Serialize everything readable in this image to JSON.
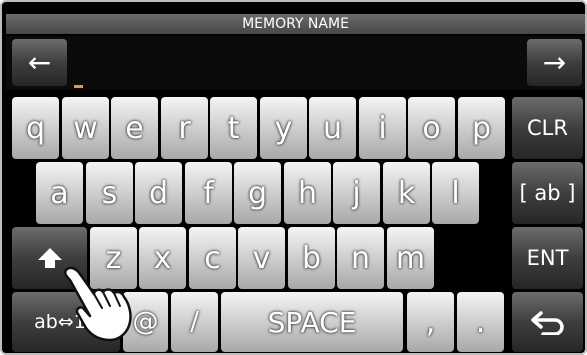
{
  "title": "MEMORY NAME",
  "name_value": "",
  "arrows": {
    "left": "←",
    "right": "→"
  },
  "rows": {
    "row1": [
      "q",
      "w",
      "e",
      "r",
      "t",
      "y",
      "u",
      "i",
      "o",
      "p"
    ],
    "row2": [
      "a",
      "s",
      "d",
      "f",
      "g",
      "h",
      "j",
      "k",
      "l"
    ],
    "row3": [
      "z",
      "x",
      "c",
      "v",
      "b",
      "n",
      "m"
    ],
    "row4": {
      "punct1": "@",
      "punct2": "/",
      "space": "SPACE",
      "comma": ",",
      "period": "."
    }
  },
  "function_keys": {
    "clr": "CLR",
    "ab": "[ ab ]",
    "ent": "ENT",
    "mode": "ab⇔12",
    "back_icon": "return-arrow-icon",
    "shift_icon": "shift-up-arrow-icon"
  },
  "colors": {
    "cursor": "#e89a2c",
    "background": "#000000",
    "key_face": "#d2d2d2"
  }
}
